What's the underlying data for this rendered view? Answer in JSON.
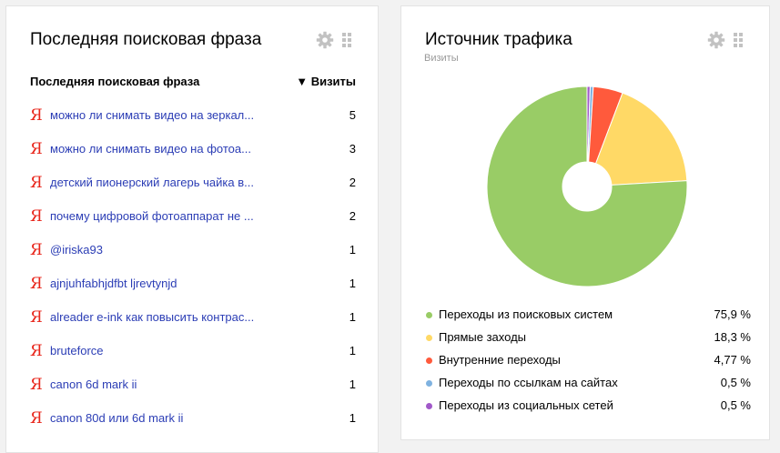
{
  "phrases_widget": {
    "title": "Последняя поисковая фраза",
    "col_phrase": "Последняя поисковая фраза",
    "col_visits": "▼ Визиты",
    "search_icon_glyph": "Я",
    "rows": [
      {
        "phrase": "можно ли снимать видео на зеркал...",
        "visits": "5"
      },
      {
        "phrase": "можно ли снимать видео на фотоа...",
        "visits": "3"
      },
      {
        "phrase": "детский пионерский лагерь чайка в...",
        "visits": "2"
      },
      {
        "phrase": "почему цифровой фотоаппарат не ...",
        "visits": "2"
      },
      {
        "phrase": "@iriska93",
        "visits": "1"
      },
      {
        "phrase": "ajnjuhfabhjdfbt ljrevtynjd",
        "visits": "1"
      },
      {
        "phrase": "alreader e-ink как повысить контрас...",
        "visits": "1"
      },
      {
        "phrase": "bruteforce",
        "visits": "1"
      },
      {
        "phrase": "canon 6d mark ii",
        "visits": "1"
      },
      {
        "phrase": "canon 80d или 6d mark ii",
        "visits": "1"
      }
    ]
  },
  "traffic_widget": {
    "title": "Источник трафика",
    "subtitle": "Визиты"
  },
  "chart_data": {
    "type": "pie",
    "donut": true,
    "legend_position": "bottom",
    "series": [
      {
        "name": "Переходы из поисковых систем",
        "value": 75.9,
        "label": "75,9 %",
        "color": "#99cc66"
      },
      {
        "name": "Прямые заходы",
        "value": 18.3,
        "label": "18,3 %",
        "color": "#ffd966"
      },
      {
        "name": "Внутренние переходы",
        "value": 4.77,
        "label": "4,77 %",
        "color": "#ff5a3c"
      },
      {
        "name": "Переходы по ссылкам на сайтах",
        "value": 0.5,
        "label": "0,5 %",
        "color": "#7fb2e0"
      },
      {
        "name": "Переходы из социальных сетей",
        "value": 0.5,
        "label": "0,5 %",
        "color": "#a159c9"
      }
    ]
  },
  "icons": {
    "settings": "gear-icon",
    "drag": "drag-handle-icon"
  },
  "colors": {
    "link": "#2b3db5",
    "yandex_red": "#e8261b",
    "tool_gray": "#c2c2c2"
  }
}
